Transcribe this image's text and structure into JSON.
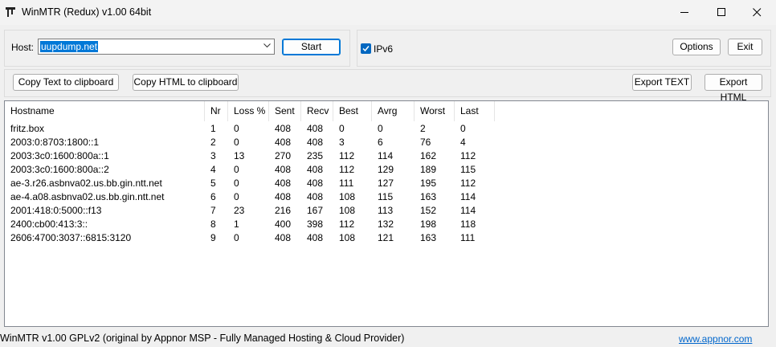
{
  "window": {
    "title": "WinMTR (Redux) v1.00 64bit"
  },
  "host": {
    "label": "Host:",
    "value": "uupdump.net"
  },
  "buttons": {
    "start": "Start",
    "options": "Options",
    "exit": "Exit",
    "copy_text": "Copy Text to clipboard",
    "copy_html": "Copy HTML to clipboard",
    "export_text": "Export TEXT",
    "export_html": "Export HTML"
  },
  "ipv6": {
    "label": "IPv6",
    "checked": true
  },
  "table": {
    "columns": [
      "Hostname",
      "Nr",
      "Loss %",
      "Sent",
      "Recv",
      "Best",
      "Avrg",
      "Worst",
      "Last"
    ],
    "rows": [
      [
        "fritz.box",
        "1",
        "0",
        "408",
        "408",
        "0",
        "0",
        "2",
        "0"
      ],
      [
        "2003:0:8703:1800::1",
        "2",
        "0",
        "408",
        "408",
        "3",
        "6",
        "76",
        "4"
      ],
      [
        "2003:3c0:1600:800a::1",
        "3",
        "13",
        "270",
        "235",
        "112",
        "114",
        "162",
        "112"
      ],
      [
        "2003:3c0:1600:800a::2",
        "4",
        "0",
        "408",
        "408",
        "112",
        "129",
        "189",
        "115"
      ],
      [
        "ae-3.r26.asbnva02.us.bb.gin.ntt.net",
        "5",
        "0",
        "408",
        "408",
        "111",
        "127",
        "195",
        "112"
      ],
      [
        "ae-4.a08.asbnva02.us.bb.gin.ntt.net",
        "6",
        "0",
        "408",
        "408",
        "108",
        "115",
        "163",
        "114"
      ],
      [
        "2001:418:0:5000::f13",
        "7",
        "23",
        "216",
        "167",
        "108",
        "113",
        "152",
        "114"
      ],
      [
        "2400:cb00:413:3::",
        "8",
        "1",
        "400",
        "398",
        "112",
        "132",
        "198",
        "118"
      ],
      [
        "2606:4700:3037::6815:3120",
        "9",
        "0",
        "408",
        "408",
        "108",
        "121",
        "163",
        "111"
      ]
    ]
  },
  "status": {
    "text": "WinMTR v1.00 GPLv2 (original by Appnor MSP - Fully Managed Hosting & Cloud Provider)",
    "link": "www.appnor.com"
  },
  "colors": {
    "accent": "#0078d7",
    "link": "#0066cc",
    "selection": "#0078d7"
  }
}
